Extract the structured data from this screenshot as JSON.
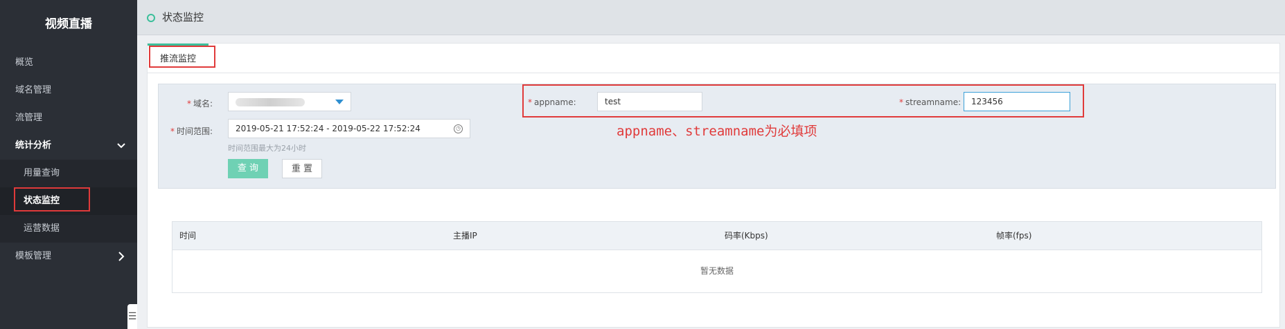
{
  "sidebar": {
    "brand": "视频直播",
    "items": [
      {
        "label": "概览"
      },
      {
        "label": "域名管理"
      },
      {
        "label": "流管理"
      },
      {
        "label": "统计分析"
      },
      {
        "label": "用量查询"
      },
      {
        "label": "状态监控"
      },
      {
        "label": "运营数据"
      },
      {
        "label": "模板管理"
      }
    ]
  },
  "header": {
    "title": "状态监控"
  },
  "tabs": [
    {
      "label": "推流监控"
    }
  ],
  "form": {
    "domain_label": "域名:",
    "appname_label": "appname:",
    "appname_value": "test",
    "streamname_label": "streamname:",
    "streamname_value": "123456",
    "time_label": "时间范围:",
    "time_value": "2019-05-21 17:52:24 - 2019-05-22 17:52:24",
    "time_hint": "时间范围最大为24小时",
    "query_button": "查 询",
    "reset_button": "重 置",
    "required_mark": "*"
  },
  "annotation": "appname、streamname为必填项",
  "table": {
    "columns": [
      "时间",
      "主播IP",
      "码率(Kbps)",
      "帧率(fps)"
    ],
    "empty_text": "暂无数据"
  },
  "colors": {
    "accent": "#3bbf9a",
    "highlight": "#e03a3a",
    "sidebar_bg": "#2b2f36"
  }
}
